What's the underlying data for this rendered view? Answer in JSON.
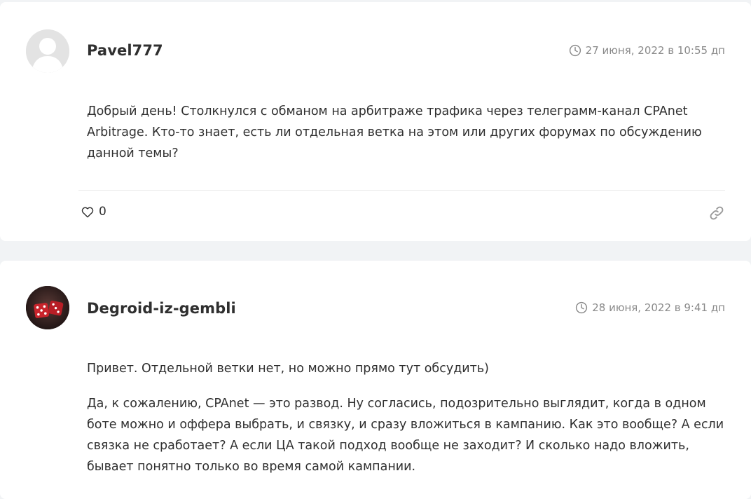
{
  "comments": [
    {
      "author": "Pavel777",
      "date": "27 июня, 2022 в 10:55 дп",
      "paragraphs": [
        "Добрый день! Столкнулся с обманом на арбитраже трафика через телеграмм-канал CPAnet Arbitrage. Кто-то знает, есть ли отдельная ветка на этом или других форумах по обсуждению данной темы?"
      ],
      "likes": "0",
      "avatar_icon": "default-user-avatar",
      "like_icon": "heart-icon",
      "permalink_icon": "link-icon"
    },
    {
      "author": "Degroid-iz-gembli",
      "date": "28 июня, 2022 в 9:41 дп",
      "paragraphs": [
        "Привет. Отдельной ветки нет, но можно прямо тут обсудить)",
        "Да, к сожалению, CPAnet — это развод. Ну согласись, подозрительно выглядит, когда в одном боте можно и оффера выбрать, и связку, и сразу вложиться в кампанию. Как это вообще? А если связка не сработает? А если ЦА такой подход вообще не заходит? И сколько надо вложить, бывает понятно только во время самой кампании."
      ],
      "avatar_icon": "red-dice-avatar"
    }
  ],
  "colors": {
    "page_background": "#f1f3f5",
    "card_background": "#ffffff",
    "text": "#2f2f2f",
    "muted": "#8a8a8a",
    "avatar_dice": "#c8242c"
  }
}
